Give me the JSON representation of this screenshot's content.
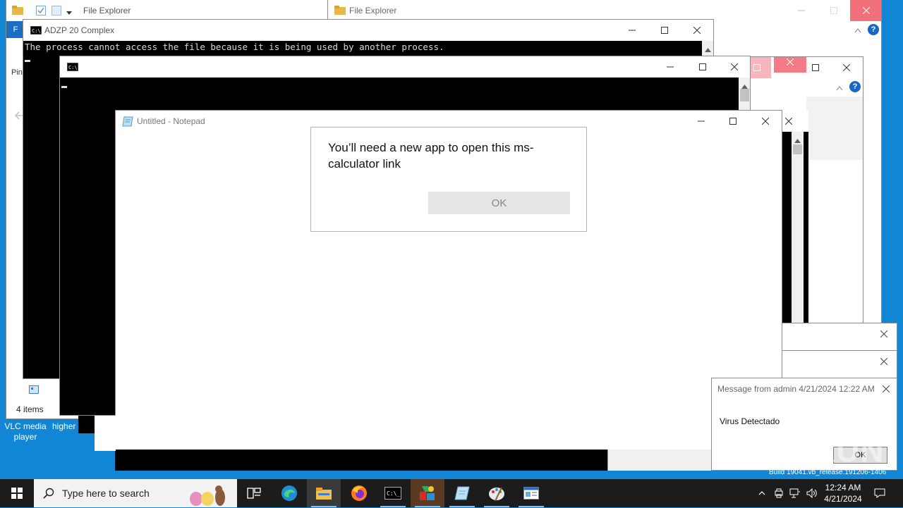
{
  "explorer_back": {
    "title": "File Explorer"
  },
  "explorer_back2": {
    "title": "File Explorer"
  },
  "explorer_behind": {
    "ribbon_tab": "F",
    "nav_label": "Pin",
    "status_count": "4 items"
  },
  "console_main": {
    "title": "ADZP 20 Complex",
    "message": "The process cannot access the file because it is being used by another process."
  },
  "notepad": {
    "title": "Untitled - Notepad"
  },
  "dialog": {
    "message": "You’ll need a new app to open this ms-calculator link",
    "ok_label": "OK"
  },
  "msg_popup": {
    "header": "Message from admin 4/21/2024 12:22 AM",
    "body": "Virus Detectado",
    "ok_label": "OK"
  },
  "desktop": {
    "icons": [
      {
        "label": "VLC media player"
      },
      {
        "label": "higher"
      }
    ],
    "build_text": "Build 19041.vb_release.191206-1406",
    "watermark": "ANY RUN"
  },
  "taskbar": {
    "search_placeholder": "Type here to search",
    "clock_time": "12:24 AM",
    "clock_date": "4/21/2024"
  },
  "colors": {
    "desktop": "#1086d4",
    "taskbar": "#1c1c1c",
    "help": "#1a66c7",
    "close_hover": "#e81123"
  }
}
